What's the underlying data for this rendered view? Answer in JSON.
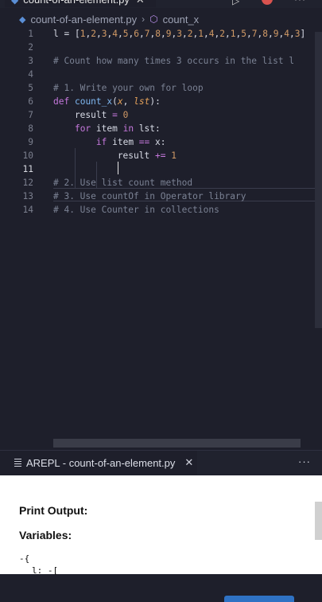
{
  "tabs": {
    "active_label": "count-of-an-element.py",
    "close_glyph": "✕",
    "file_icon": "python-icon"
  },
  "breadcrumb": {
    "file": "count-of-an-element.py",
    "separator": "›",
    "symbol": "count_x"
  },
  "editor": {
    "line_numbers": [
      "1",
      "2",
      "3",
      "4",
      "5",
      "6",
      "7",
      "8",
      "9",
      "10",
      "11",
      "12",
      "13",
      "14"
    ],
    "current_line": "11"
  },
  "panel": {
    "tab_label": "AREPL - count-of-an-element.py",
    "more_glyph": "···",
    "print_output_label": "Print Output:",
    "variables_label": "Variables:",
    "tree_line1": "-{",
    "tree_line2": "l: -["
  },
  "colors": {
    "background": "#1e1f2b",
    "keyword": "#c678dd",
    "function": "#7fb7f0",
    "param": "#e7a35b",
    "number": "#d19a66",
    "comment": "#7b8294"
  }
}
